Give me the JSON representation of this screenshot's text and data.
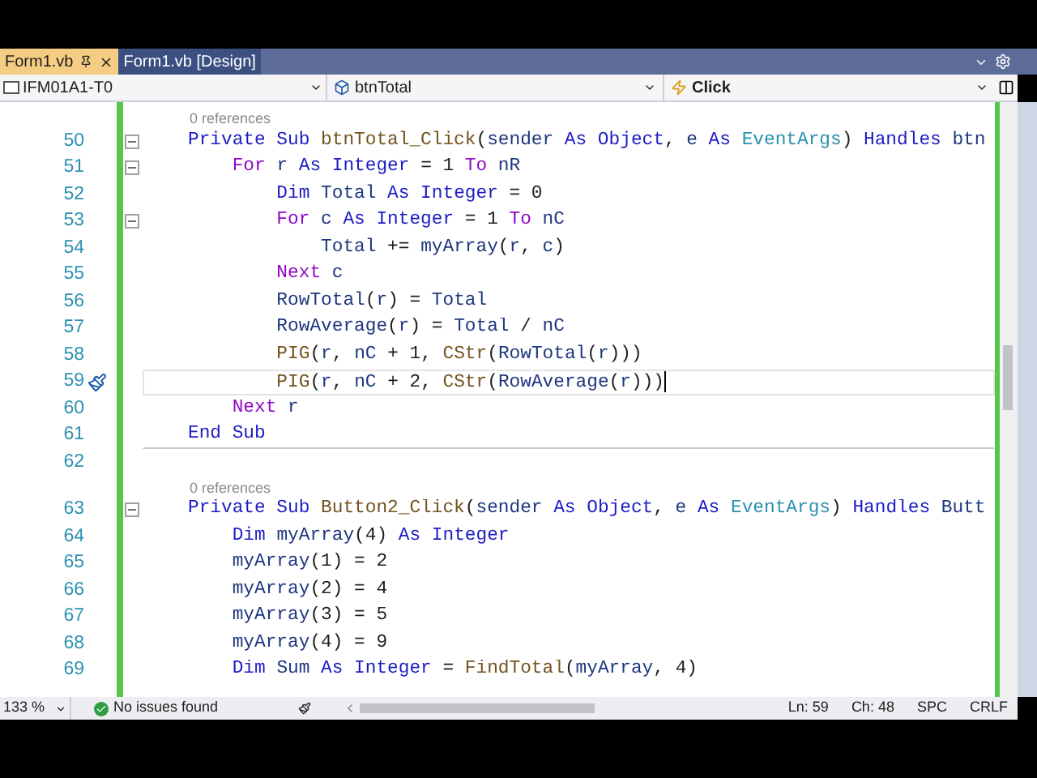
{
  "tabs": [
    {
      "label": "Form1.vb",
      "selected": true
    },
    {
      "label": "Form1.vb [Design]",
      "selected": false
    }
  ],
  "navigation_bar": {
    "project": "IFM01A1-T0",
    "object": "btnTotal",
    "event": "Click"
  },
  "editor": {
    "rows": [
      {
        "kind": "codelens",
        "text": "0 references"
      },
      {
        "kind": "code",
        "number": "50",
        "fold": true,
        "current": false,
        "tokens": [
          {
            "kind": "keyword",
            "text": "Private Sub "
          },
          {
            "kind": "method",
            "text": "btnTotal_Click"
          },
          {
            "kind": "plain",
            "text": "("
          },
          {
            "kind": "identifier",
            "text": "sender"
          },
          {
            "kind": "keyword",
            "text": " As Object"
          },
          {
            "kind": "plain",
            "text": ", "
          },
          {
            "kind": "identifier",
            "text": "e"
          },
          {
            "kind": "keyword",
            "text": " As "
          },
          {
            "kind": "type",
            "text": "EventArgs"
          },
          {
            "kind": "plain",
            "text": ") "
          },
          {
            "kind": "keyword",
            "text": "Handles"
          },
          {
            "kind": "identifier",
            "text": " btn"
          }
        ]
      },
      {
        "kind": "code",
        "number": "51",
        "fold": true,
        "current": false,
        "tokens": [
          {
            "kind": "control",
            "text": "    For"
          },
          {
            "kind": "identifier",
            "text": " r"
          },
          {
            "kind": "keyword",
            "text": " As Integer"
          },
          {
            "kind": "plain",
            "text": " = 1 "
          },
          {
            "kind": "control",
            "text": "To"
          },
          {
            "kind": "identifier",
            "text": " nR"
          }
        ]
      },
      {
        "kind": "code",
        "number": "52",
        "fold": false,
        "current": false,
        "tokens": [
          {
            "kind": "keyword",
            "text": "        Dim"
          },
          {
            "kind": "identifier",
            "text": " Total"
          },
          {
            "kind": "keyword",
            "text": " As Integer"
          },
          {
            "kind": "plain",
            "text": " = 0"
          }
        ]
      },
      {
        "kind": "code",
        "number": "53",
        "fold": true,
        "current": false,
        "tokens": [
          {
            "kind": "control",
            "text": "        For"
          },
          {
            "kind": "identifier",
            "text": " c"
          },
          {
            "kind": "keyword",
            "text": " As Integer"
          },
          {
            "kind": "plain",
            "text": " = 1 "
          },
          {
            "kind": "control",
            "text": "To"
          },
          {
            "kind": "identifier",
            "text": " nC"
          }
        ]
      },
      {
        "kind": "code",
        "number": "54",
        "fold": false,
        "current": false,
        "tokens": [
          {
            "kind": "identifier",
            "text": "            Total"
          },
          {
            "kind": "plain",
            "text": " += "
          },
          {
            "kind": "identifier",
            "text": "myArray"
          },
          {
            "kind": "plain",
            "text": "("
          },
          {
            "kind": "identifier",
            "text": "r"
          },
          {
            "kind": "plain",
            "text": ", "
          },
          {
            "kind": "identifier",
            "text": "c"
          },
          {
            "kind": "plain",
            "text": ")"
          }
        ]
      },
      {
        "kind": "code",
        "number": "55",
        "fold": false,
        "current": false,
        "tokens": [
          {
            "kind": "control",
            "text": "        Next"
          },
          {
            "kind": "identifier",
            "text": " c"
          }
        ]
      },
      {
        "kind": "code",
        "number": "56",
        "fold": false,
        "current": false,
        "tokens": [
          {
            "kind": "identifier",
            "text": "        RowTotal"
          },
          {
            "kind": "plain",
            "text": "("
          },
          {
            "kind": "identifier",
            "text": "r"
          },
          {
            "kind": "plain",
            "text": ") = "
          },
          {
            "kind": "identifier",
            "text": "Total"
          }
        ]
      },
      {
        "kind": "code",
        "number": "57",
        "fold": false,
        "current": false,
        "tokens": [
          {
            "kind": "identifier",
            "text": "        RowAverage"
          },
          {
            "kind": "plain",
            "text": "("
          },
          {
            "kind": "identifier",
            "text": "r"
          },
          {
            "kind": "plain",
            "text": ") = "
          },
          {
            "kind": "identifier",
            "text": "Total"
          },
          {
            "kind": "plain",
            "text": " / "
          },
          {
            "kind": "identifier",
            "text": "nC"
          }
        ]
      },
      {
        "kind": "code",
        "number": "58",
        "fold": false,
        "current": false,
        "tokens": [
          {
            "kind": "method",
            "text": "        PIG"
          },
          {
            "kind": "plain",
            "text": "("
          },
          {
            "kind": "identifier",
            "text": "r"
          },
          {
            "kind": "plain",
            "text": ", "
          },
          {
            "kind": "identifier",
            "text": "nC"
          },
          {
            "kind": "plain",
            "text": " + 1, "
          },
          {
            "kind": "method",
            "text": "CStr"
          },
          {
            "kind": "plain",
            "text": "("
          },
          {
            "kind": "identifier",
            "text": "RowTotal"
          },
          {
            "kind": "plain",
            "text": "("
          },
          {
            "kind": "identifier",
            "text": "r"
          },
          {
            "kind": "plain",
            "text": ")))"
          }
        ]
      },
      {
        "kind": "code",
        "number": "59",
        "fold": false,
        "current": true,
        "quick_action": true,
        "tokens": [
          {
            "kind": "method",
            "text": "        PIG"
          },
          {
            "kind": "plain",
            "text": "("
          },
          {
            "kind": "identifier",
            "text": "r"
          },
          {
            "kind": "plain",
            "text": ", "
          },
          {
            "kind": "identifier",
            "text": "nC"
          },
          {
            "kind": "plain",
            "text": " + 2, "
          },
          {
            "kind": "method",
            "text": "CStr"
          },
          {
            "kind": "plain",
            "text": "("
          },
          {
            "kind": "identifier",
            "text": "RowAverage"
          },
          {
            "kind": "plain",
            "text": "("
          },
          {
            "kind": "identifier",
            "text": "r"
          },
          {
            "kind": "plain",
            "text": ")))"
          }
        ]
      },
      {
        "kind": "code",
        "number": "60",
        "fold": false,
        "current": false,
        "tokens": [
          {
            "kind": "control",
            "text": "    Next"
          },
          {
            "kind": "identifier",
            "text": " r"
          }
        ]
      },
      {
        "kind": "code",
        "number": "61",
        "fold": false,
        "current": false,
        "separator_below": true,
        "tokens": [
          {
            "kind": "keyword",
            "text": "End Sub"
          }
        ]
      },
      {
        "kind": "code",
        "number": "62",
        "fold": false,
        "current": false
      },
      {
        "kind": "codelens",
        "text": "0 references"
      },
      {
        "kind": "code",
        "number": "63",
        "fold": true,
        "current": false,
        "tokens": [
          {
            "kind": "keyword",
            "text": "Private Sub "
          },
          {
            "kind": "method",
            "text": "Button2_Click"
          },
          {
            "kind": "plain",
            "text": "("
          },
          {
            "kind": "identifier",
            "text": "sender"
          },
          {
            "kind": "keyword",
            "text": " As Object"
          },
          {
            "kind": "plain",
            "text": ", "
          },
          {
            "kind": "identifier",
            "text": "e"
          },
          {
            "kind": "keyword",
            "text": " As "
          },
          {
            "kind": "type",
            "text": "EventArgs"
          },
          {
            "kind": "plain",
            "text": ") "
          },
          {
            "kind": "keyword",
            "text": "Handles"
          },
          {
            "kind": "identifier",
            "text": " Butt"
          }
        ]
      },
      {
        "kind": "code",
        "number": "64",
        "fold": false,
        "current": false,
        "tokens": [
          {
            "kind": "keyword",
            "text": "    Dim"
          },
          {
            "kind": "identifier",
            "text": " myArray"
          },
          {
            "kind": "plain",
            "text": "(4) "
          },
          {
            "kind": "keyword",
            "text": "As Integer"
          }
        ]
      },
      {
        "kind": "code",
        "number": "65",
        "fold": false,
        "current": false,
        "tokens": [
          {
            "kind": "identifier",
            "text": "    myArray"
          },
          {
            "kind": "plain",
            "text": "(1) = 2"
          }
        ]
      },
      {
        "kind": "code",
        "number": "66",
        "fold": false,
        "current": false,
        "tokens": [
          {
            "kind": "identifier",
            "text": "    myArray"
          },
          {
            "kind": "plain",
            "text": "(2) = 4"
          }
        ]
      },
      {
        "kind": "code",
        "number": "67",
        "fold": false,
        "current": false,
        "tokens": [
          {
            "kind": "identifier",
            "text": "    myArray"
          },
          {
            "kind": "plain",
            "text": "(3) = 5"
          }
        ]
      },
      {
        "kind": "code",
        "number": "68",
        "fold": false,
        "current": false,
        "tokens": [
          {
            "kind": "identifier",
            "text": "    myArray"
          },
          {
            "kind": "plain",
            "text": "(4) = 9"
          }
        ]
      },
      {
        "kind": "code",
        "number": "69",
        "fold": false,
        "current": false,
        "tokens": [
          {
            "kind": "keyword",
            "text": "    Dim"
          },
          {
            "kind": "identifier",
            "text": " Sum"
          },
          {
            "kind": "keyword",
            "text": " As Integer"
          },
          {
            "kind": "plain",
            "text": " = "
          },
          {
            "kind": "method",
            "text": "FindTotal"
          },
          {
            "kind": "plain",
            "text": "("
          },
          {
            "kind": "identifier",
            "text": "myArray"
          },
          {
            "kind": "plain",
            "text": ", 4)"
          }
        ]
      }
    ]
  },
  "status_bar": {
    "zoom": "133 %",
    "issues": "No issues found",
    "position": [
      "Ln: 59",
      "Ch: 48",
      "SPC",
      "CRLF"
    ]
  }
}
